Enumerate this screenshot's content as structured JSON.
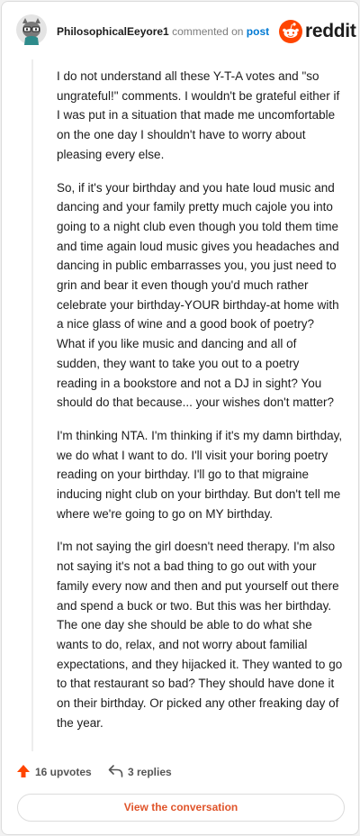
{
  "comment": {
    "username": "PhilosophicalEeyore1",
    "action_text": "commented on",
    "post_link": "post",
    "paragraphs": [
      "I do not understand all these Y-T-A votes and \"so ungrateful!\" comments. I wouldn't be grateful either if I was put in a situation that made me uncomfortable on the one day I shouldn't have to worry about pleasing every else.",
      "So, if it's your birthday and you hate loud music and dancing and your family pretty much cajole you into going to a night club even though you told them time and time again loud music gives you headaches and dancing in public embarrasses you, you just need to grin and bear it even though you'd much rather celebrate your birthday-YOUR birthday-at home with a nice glass of wine and a good book of poetry? What if you like music and dancing and all of sudden, they want to take you out to a poetry reading in a bookstore and not a DJ in sight? You should do that because... your wishes don't matter?",
      "I'm thinking NTA. I'm thinking if it's my damn birthday, we do what I want to do. I'll visit your boring poetry reading on your birthday. I'll go to that migraine inducing night club on your birthday. But don't tell me where we're going to go on MY birthday.",
      "I'm not saying the girl doesn't need therapy. I'm also not saying it's not a bad thing to go out with your family every now and then and put yourself out there and spend a buck or two. But this was her birthday. The one day she should be able to do what she wants to do, relax, and not worry about familial expectations, and they hijacked it. They wanted to go to that restaurant so bad? They should have done it on their birthday. Or picked any other freaking day of the year."
    ]
  },
  "brand": {
    "name": "reddit",
    "icon": "reddit-snoo-icon",
    "color": "#ff4500"
  },
  "footer": {
    "upvotes": "16 upvotes",
    "replies": "3 replies",
    "view_button": "View the conversation"
  },
  "colors": {
    "upvote": "#ff4500",
    "link": "#0079d3",
    "button_text": "#e0542a"
  }
}
